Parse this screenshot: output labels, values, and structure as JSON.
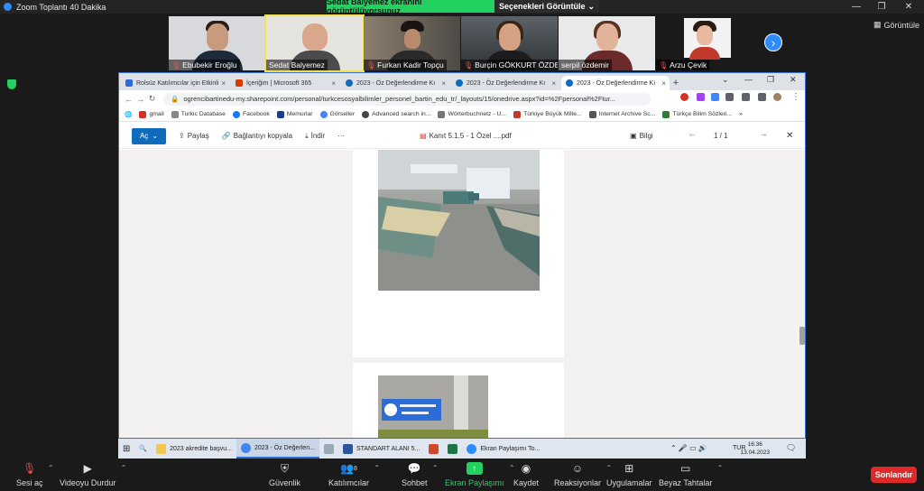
{
  "zoom": {
    "window_title": "Zoom Toplantı 40 Dakika",
    "share_banner": "Sedat Balyemez ekranını görüntülüyorsunuz",
    "view_options": "Seçenekleri Görüntüle",
    "view_button": "Görüntüle"
  },
  "participants": [
    {
      "name": "Ebubekir Eroğlu",
      "muted": true
    },
    {
      "name": "Sedat Balyemez",
      "muted": false
    },
    {
      "name": "Furkan Kadir Topçu",
      "muted": true
    },
    {
      "name": "Burçin GÖKKURT ÖZDEMİR",
      "muted": true
    },
    {
      "name": "serpil özdemir",
      "muted": false
    },
    {
      "name": "Arzu Çevik",
      "muted": true
    }
  ],
  "browser": {
    "tabs": [
      {
        "label": "Rolsüz Katılımcılar için Etkinli",
        "color": "#2b6cd6"
      },
      {
        "label": "İçeriğim | Microsoft 365",
        "color": "#d83b01"
      },
      {
        "label": "2023 - Öz Değerlendirme Kı",
        "color": "#0f6cbd"
      },
      {
        "label": "2023 - Öz Değerlendirme Kı",
        "color": "#0f6cbd"
      },
      {
        "label": "2023 - Öz Değerlendirme Kı",
        "color": "#0f6cbd"
      }
    ],
    "url": "ogrencibartinedu-my.sharepoint.com/personal/turkcesosyalbilimler_personel_bartin_edu_tr/_layouts/15/onedrive.aspx?id=%2Fpersonal%2Ftur...",
    "bookmarks": [
      {
        "label": "gmail",
        "color": "#d93025"
      },
      {
        "label": "Turkic Database",
        "color": "#888888"
      },
      {
        "label": "Facebook",
        "color": "#1877f2"
      },
      {
        "label": "Memurlar",
        "color": "#1a3c8c"
      },
      {
        "label": "Görseller",
        "color": "#4285f4"
      },
      {
        "label": "Advanced search in...",
        "color": "#444444"
      },
      {
        "label": "Wörterbuchnetz - U...",
        "color": "#777777"
      },
      {
        "label": "Türkiye Büyük Mille...",
        "color": "#c0392b"
      },
      {
        "label": "Internet Archive Sc...",
        "color": "#555555"
      },
      {
        "label": "Türkçe Bilim Sözleri...",
        "color": "#2e7d32"
      }
    ]
  },
  "onedrive": {
    "open_button": "Aç",
    "share": "Paylaş",
    "copy_link": "Bağlantıyı kopyala",
    "download": "İndir",
    "more": "···",
    "file_name": "Kanıt 5.1.5 - 1 Özel ....pdf",
    "info": "Bilgi",
    "page_counter": "1 / 1"
  },
  "taskbar": {
    "items": [
      {
        "label": "2023 akredite başvu...",
        "color": "#f2c94c"
      },
      {
        "label": "2023 - Öz Değerlen...",
        "color": "#4285f4"
      },
      {
        "label": "",
        "color": "#9aa7b5"
      },
      {
        "label": "STANDART ALANI 5...",
        "color": "#2b579a"
      },
      {
        "label": "",
        "color": "#d24726"
      },
      {
        "label": "",
        "color": "#217346"
      },
      {
        "label": "Ekran Paylaşımı To...",
        "color": "#2d8cff"
      }
    ],
    "language": "TUR",
    "time": "16:36",
    "date": "13.04.2023"
  },
  "controls": {
    "mute": "Sesi aç",
    "video": "Videoyu Durdur",
    "security": "Güvenlik",
    "participants": "Katılımcılar",
    "participants_count": "8",
    "chat": "Sohbet",
    "share": "Ekran Paylaşımı",
    "record": "Kaydet",
    "reactions": "Reaksiyonlar",
    "apps": "Uygulamalar",
    "whiteboard": "Beyaz Tahtalar",
    "end": "Sonlandır"
  }
}
